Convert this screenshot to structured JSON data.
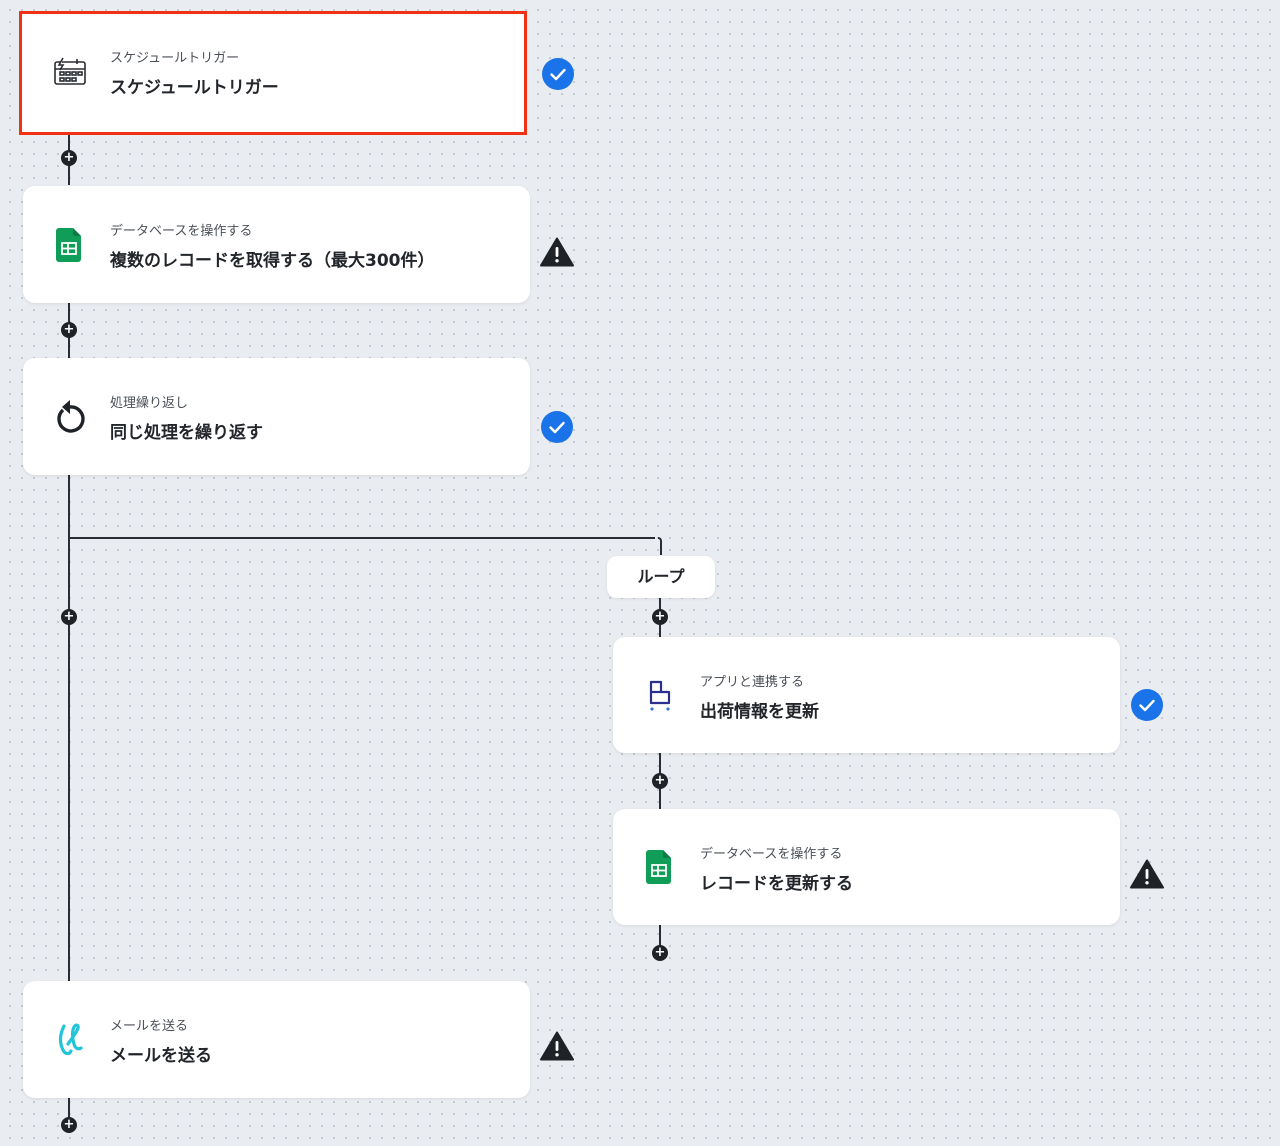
{
  "flow": {
    "trigger": {
      "subtitle": "スケジュールトリガー",
      "title": "スケジュールトリガー",
      "status": "ok"
    },
    "step_get_records": {
      "subtitle": "データベースを操作する",
      "title": "複数のレコードを取得する（最大300件）",
      "status": "warning"
    },
    "step_loop": {
      "subtitle": "処理繰り返し",
      "title": "同じ処理を繰り返す",
      "status": "ok"
    },
    "loop_branch": {
      "label": "ループ"
    },
    "step_update_shipping": {
      "subtitle": "アプリと連携する",
      "title": "出荷情報を更新",
      "status": "ok"
    },
    "step_update_record": {
      "subtitle": "データベースを操作する",
      "title": "レコードを更新する",
      "status": "warning"
    },
    "step_send_mail": {
      "subtitle": "メールを送る",
      "title": "メールを送る",
      "status": "warning"
    },
    "add_step_symbol": "+"
  },
  "colors": {
    "selected_border": "#f03114",
    "check_blue": "#1a73e8",
    "warning_dark": "#1f2227",
    "sheets_green": "#0f9d58",
    "mail_teal": "#22c4d8",
    "connector": "#2a2d33"
  }
}
